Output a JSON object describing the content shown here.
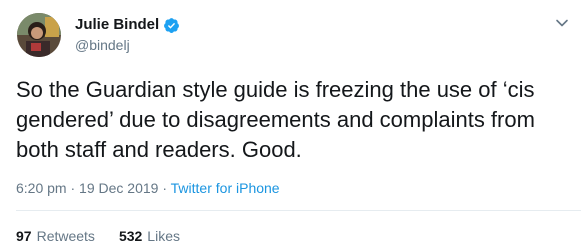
{
  "user": {
    "display_name": "Julie Bindel",
    "handle": "@bindelj",
    "verified": true
  },
  "tweet": {
    "text": "So the Guardian style guide is freezing the use of ‘cis gendered’ due to disagreements and complaints from both staff and readers. Good.",
    "time": "6:20 pm",
    "separator_1": " · ",
    "date": "19 Dec 2019",
    "separator_2": " · ",
    "source": "Twitter for iPhone"
  },
  "stats": {
    "retweets_count": "97",
    "retweets_label": "Retweets",
    "likes_count": "532",
    "likes_label": "Likes"
  },
  "icons": {
    "verified": "verified-badge-icon",
    "more": "chevron-down-icon"
  },
  "colors": {
    "text": "#14171a",
    "secondary": "#657786",
    "link": "#1b95e0",
    "verified": "#1da1f2"
  }
}
